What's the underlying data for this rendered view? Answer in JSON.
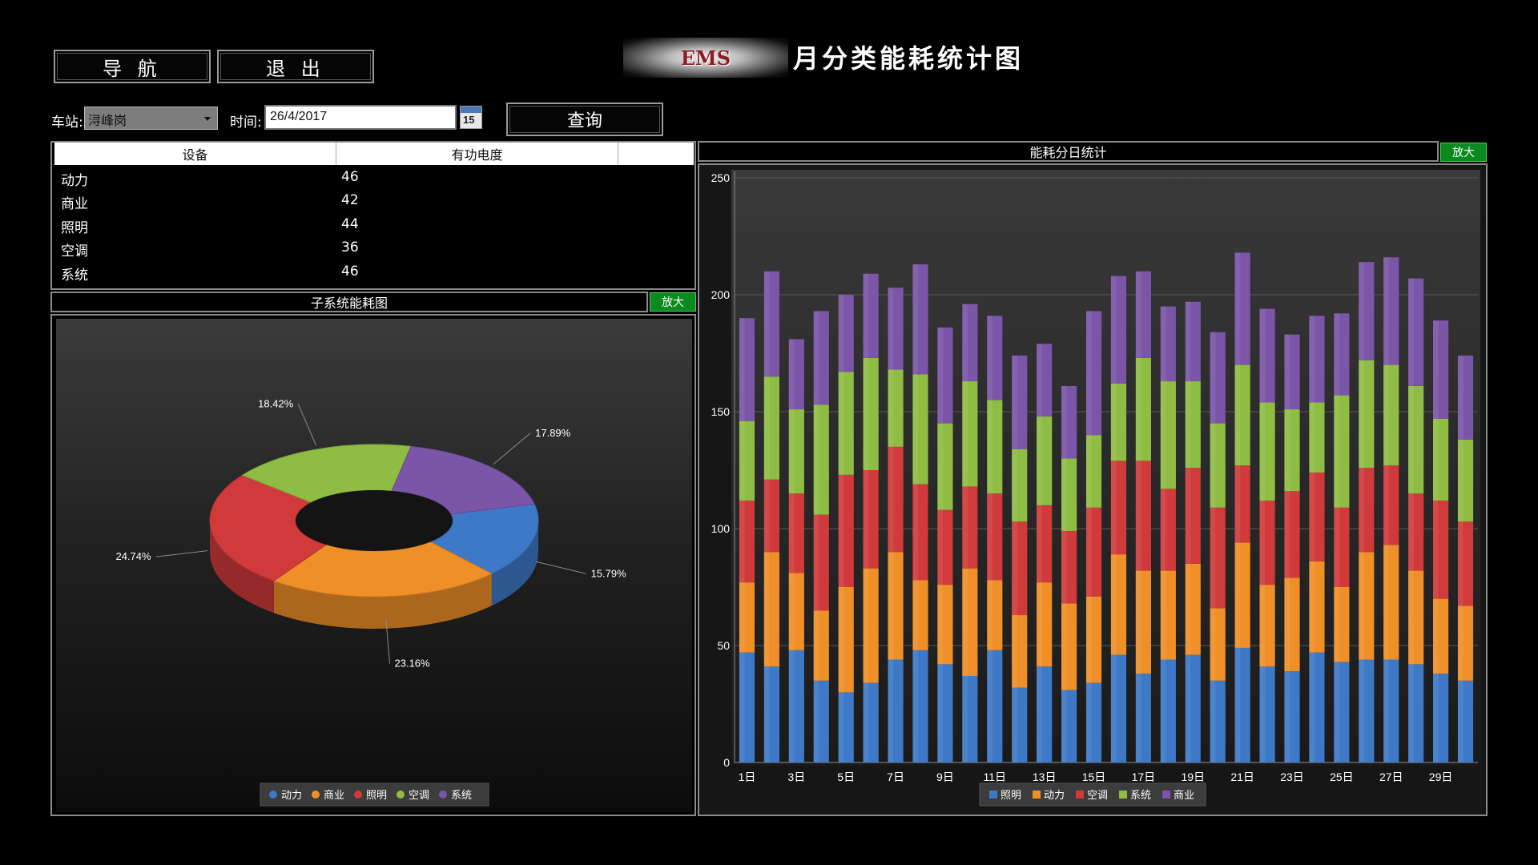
{
  "header": {
    "nav_button": "导 航",
    "exit_button": "退 出",
    "logo_text": "EMS",
    "title": "月分类能耗统计图"
  },
  "filters": {
    "station_label": "车站:",
    "station_value": "浔峰岗",
    "time_label": "时间:",
    "date_value": "26/4/2017",
    "calendar_number": "15",
    "query_button": "查询"
  },
  "table": {
    "headers": [
      "设备",
      "有功电度",
      ""
    ],
    "rows": [
      {
        "name": "动力",
        "value": "46"
      },
      {
        "name": "商业",
        "value": "42"
      },
      {
        "name": "照明",
        "value": "44"
      },
      {
        "name": "空调",
        "value": "36"
      },
      {
        "name": "系统",
        "value": "46"
      }
    ]
  },
  "donut_panel": {
    "title": "子系统能耗图",
    "zoom": "放大"
  },
  "bar_panel": {
    "title": "能耗分日统计",
    "zoom": "放大"
  },
  "colors": {
    "blue": "#3d79c6",
    "orange": "#ef8f28",
    "red": "#d13a3a",
    "green": "#8fbd44",
    "purple": "#7b55a8"
  },
  "chart_data": [
    {
      "type": "pie",
      "subtype": "donut-3d",
      "slices": [
        {
          "label": "动力",
          "value": 15.79,
          "label_text": "15.79%",
          "color": "#3d79c6"
        },
        {
          "label": "商业",
          "value": 23.16,
          "label_text": "23.16%",
          "color": "#ef8f28"
        },
        {
          "label": "照明",
          "value": 24.74,
          "label_text": "24.74%",
          "color": "#d13a3a"
        },
        {
          "label": "空调",
          "value": 18.42,
          "label_text": "18.42%",
          "color": "#8fbd44"
        },
        {
          "label": "系统",
          "value": 17.89,
          "label_text": "17.89%",
          "color": "#7b55a8"
        }
      ],
      "legend": [
        "动力",
        "商业",
        "照明",
        "空调",
        "系统"
      ],
      "legend_position": "bottom"
    },
    {
      "type": "bar",
      "stacked": true,
      "categories": [
        "1日",
        "2日",
        "3日",
        "4日",
        "5日",
        "6日",
        "7日",
        "8日",
        "9日",
        "10日",
        "11日",
        "12日",
        "13日",
        "14日",
        "15日",
        "16日",
        "17日",
        "18日",
        "19日",
        "20日",
        "21日",
        "22日",
        "23日",
        "24日",
        "25日",
        "26日",
        "27日",
        "28日",
        "29日",
        "30日"
      ],
      "tick_labels": [
        "1日",
        "3日",
        "5日",
        "7日",
        "9日",
        "11日",
        "13日",
        "15日",
        "17日",
        "19日",
        "21日",
        "23日",
        "25日",
        "27日",
        "29日"
      ],
      "ylim": [
        0,
        250
      ],
      "yticks": [
        0,
        50,
        100,
        150,
        200,
        250
      ],
      "grid": true,
      "legend_position": "bottom",
      "series": [
        {
          "name": "照明",
          "color": "#3d79c6",
          "values": [
            47,
            41,
            48,
            35,
            30,
            34,
            44,
            48,
            42,
            37,
            48,
            32,
            41,
            31,
            34,
            46,
            38,
            44,
            46,
            35,
            49,
            41,
            39,
            47,
            43,
            44,
            44,
            42,
            38,
            35
          ]
        },
        {
          "name": "动力",
          "color": "#ef8f28",
          "values": [
            30,
            49,
            33,
            30,
            45,
            49,
            46,
            30,
            34,
            46,
            30,
            31,
            36,
            37,
            37,
            43,
            44,
            38,
            39,
            31,
            45,
            35,
            40,
            39,
            32,
            46,
            49,
            40,
            32,
            32
          ]
        },
        {
          "name": "空调",
          "color": "#d13a3a",
          "values": [
            35,
            31,
            34,
            41,
            48,
            42,
            45,
            41,
            32,
            35,
            37,
            40,
            33,
            31,
            38,
            40,
            47,
            35,
            41,
            43,
            33,
            36,
            37,
            38,
            34,
            36,
            34,
            33,
            42,
            36
          ]
        },
        {
          "name": "系统",
          "color": "#8fbd44",
          "values": [
            34,
            44,
            36,
            47,
            44,
            48,
            33,
            47,
            37,
            45,
            40,
            31,
            38,
            31,
            31,
            33,
            44,
            46,
            37,
            36,
            43,
            42,
            35,
            30,
            48,
            46,
            43,
            46,
            35,
            35
          ]
        },
        {
          "name": "商业",
          "color": "#7b55a8",
          "values": [
            44,
            45,
            30,
            40,
            33,
            36,
            35,
            47,
            41,
            33,
            36,
            40,
            31,
            31,
            53,
            46,
            37,
            32,
            34,
            39,
            48,
            40,
            32,
            37,
            35,
            42,
            46,
            46,
            42,
            36
          ]
        }
      ]
    }
  ]
}
